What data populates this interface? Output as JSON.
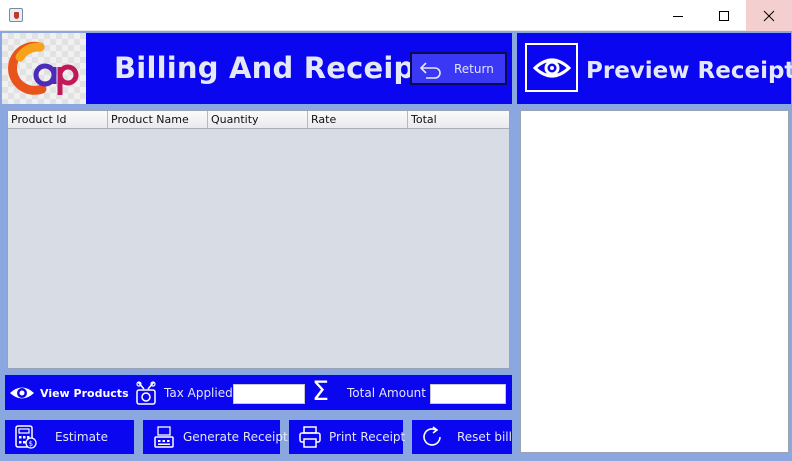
{
  "window": {
    "title": "",
    "controls": {
      "minimize": "minimize-icon",
      "maximize": "maximize-icon",
      "close": "close-icon"
    }
  },
  "header": {
    "title": "Billing And Receipt",
    "return_label": "Return",
    "logo_text": "cap"
  },
  "preview": {
    "title": "Preview Receipt"
  },
  "table": {
    "columns": [
      "Product Id",
      "Product Name",
      "Quantity",
      "Rate",
      "Total"
    ],
    "rows": []
  },
  "tax_bar": {
    "view_products_label": "View Products",
    "tax_label": "Tax Applied",
    "tax_value": "",
    "total_label": "Total Amount",
    "total_value": ""
  },
  "actions": {
    "estimate": "Estimate",
    "generate": "Generate Receipt",
    "print": "Print Receipt",
    "reset": "Reset bill"
  },
  "colors": {
    "panel_blue": "#0a06f0",
    "background": "#8aa7e0",
    "text_light": "#e4e7f6"
  }
}
